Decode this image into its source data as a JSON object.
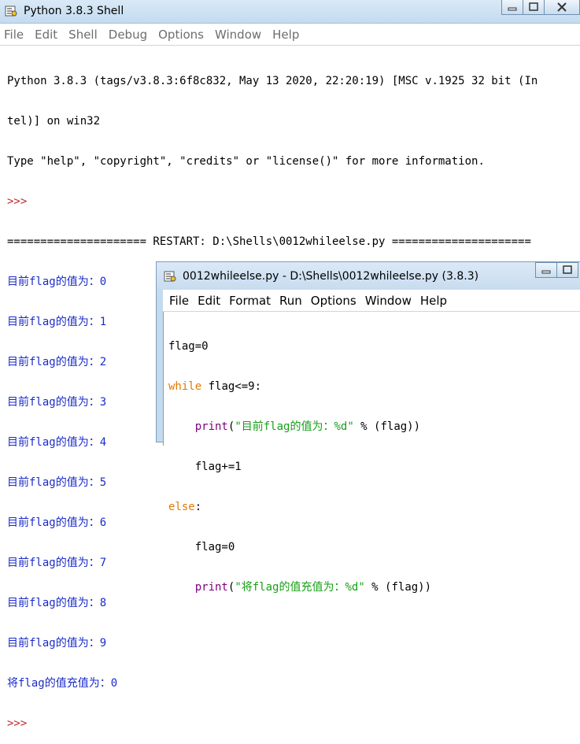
{
  "shell": {
    "title": "Python 3.8.3 Shell",
    "menu": [
      "File",
      "Edit",
      "Shell",
      "Debug",
      "Options",
      "Window",
      "Help"
    ],
    "banner": [
      "Python 3.8.3 (tags/v3.8.3:6f8c832, May 13 2020, 22:20:19) [MSC v.1925 32 bit (In",
      "tel)] on win32",
      "Type \"help\", \"copyright\", \"credits\" or \"license()\" for more information."
    ],
    "prompt": ">>>",
    "restart_line": "===================== RESTART: D:\\Shells\\0012whileelse.py =====================",
    "output": [
      "目前flag的值为：0",
      "目前flag的值为：1",
      "目前flag的值为：2",
      "目前flag的值为：3",
      "目前flag的值为：4",
      "目前flag的值为：5",
      "目前flag的值为：6",
      "目前flag的值为：7",
      "目前flag的值为：8",
      "目前flag的值为：9",
      "将flag的值充值为：0"
    ]
  },
  "editor": {
    "title": "0012whileelse.py - D:\\Shells\\0012whileelse.py (3.8.3)",
    "menu": [
      "File",
      "Edit",
      "Format",
      "Run",
      "Options",
      "Window",
      "Help"
    ],
    "code": {
      "l1": "flag=0",
      "l2_kw": "while",
      "l2_rest": " flag<=9:",
      "l3_indent": "    ",
      "l3_fn": "print",
      "l3_p1": "(",
      "l3_str": "\"目前flag的值为：%d\"",
      "l3_rest": " % (flag))",
      "l4": "    flag+=1",
      "l5_kw": "else",
      "l5_rest": ":",
      "l6": "    flag=0",
      "l7_indent": "    ",
      "l7_fn": "print",
      "l7_p1": "(",
      "l7_str": "\"将flag的值充值为：%d\"",
      "l7_rest": " % (flag))"
    }
  }
}
